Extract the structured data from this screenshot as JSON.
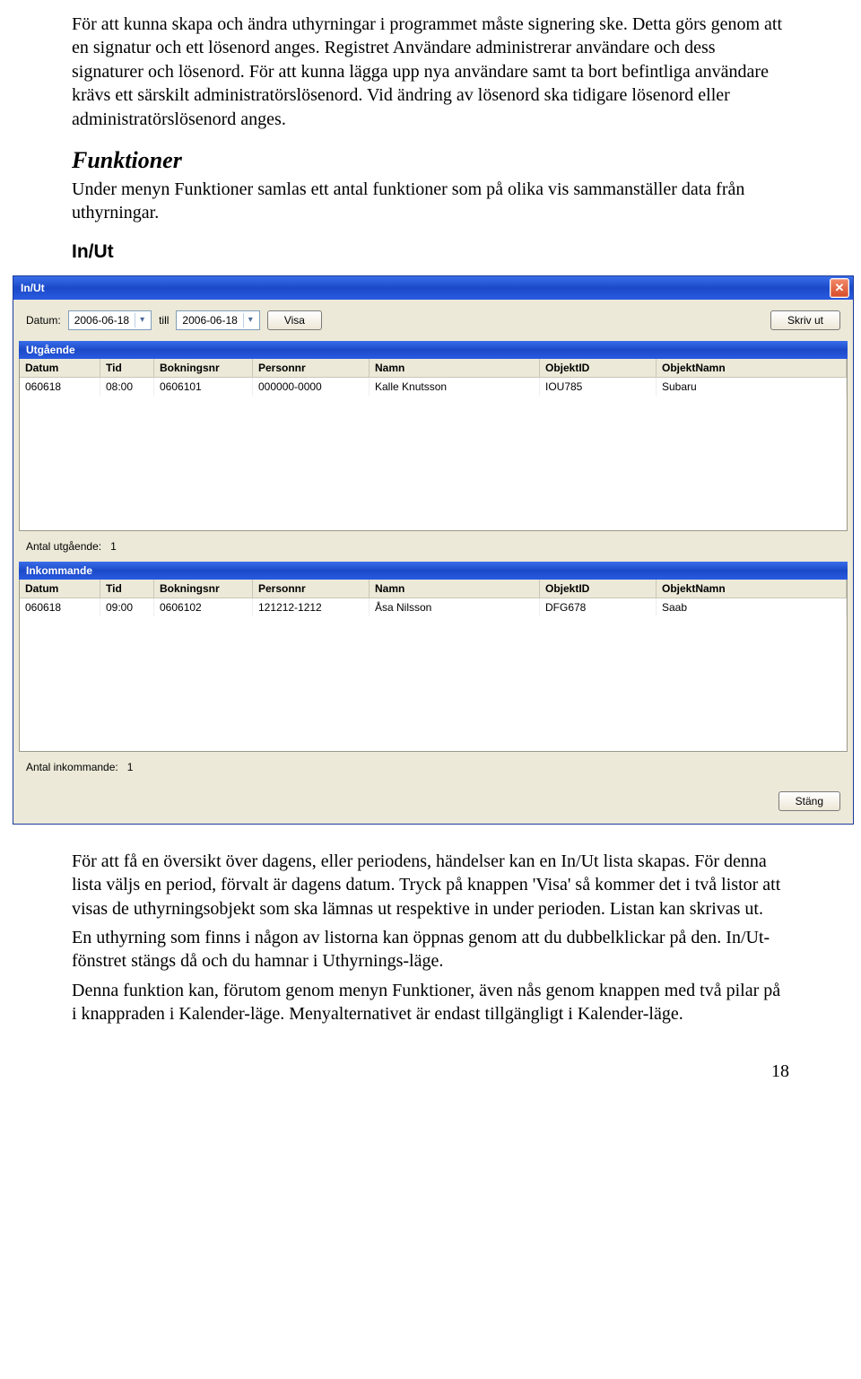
{
  "intro": {
    "p1": "För att kunna skapa och ändra uthyrningar i programmet måste signering ske. Detta görs genom att en signatur och ett lösenord anges. Registret Användare administrerar användare och dess signaturer och lösenord. För att kunna lägga upp nya användare samt ta bort befintliga användare krävs ett särskilt administratörslösenord. Vid ändring av lösenord ska tidigare lösenord eller administratörslösenord anges."
  },
  "funktioner": {
    "heading": "Funktioner",
    "p": "Under menyn Funktioner samlas ett antal funktioner som på olika vis sammanställer data från uthyrningar."
  },
  "inut_heading": "In/Ut",
  "dialog": {
    "title": "In/Ut",
    "labels": {
      "datum": "Datum:",
      "till": "till",
      "visa": "Visa",
      "skrivut": "Skriv ut",
      "stang": "Stäng"
    },
    "date_from": "2006-06-18",
    "date_to": "2006-06-18",
    "outgoing": {
      "title": "Utgående",
      "headers": [
        "Datum",
        "Tid",
        "Bokningsnr",
        "Personnr",
        "Namn",
        "ObjektID",
        "ObjektNamn"
      ],
      "rows": [
        [
          "060618",
          "08:00",
          "0606101",
          "000000-0000",
          "Kalle Knutsson",
          "IOU785",
          "Subaru"
        ]
      ],
      "count_label": "Antal utgående:",
      "count": "1"
    },
    "incoming": {
      "title": "Inkommande",
      "headers": [
        "Datum",
        "Tid",
        "Bokningsnr",
        "Personnr",
        "Namn",
        "ObjektID",
        "ObjektNamn"
      ],
      "rows": [
        [
          "060618",
          "09:00",
          "0606102",
          "121212-1212",
          "Åsa Nilsson",
          "DFG678",
          "Saab"
        ]
      ],
      "count_label": "Antal inkommande:",
      "count": "1"
    }
  },
  "after": {
    "p1": "För att få en översikt över dagens, eller periodens, händelser kan en In/Ut lista skapas. För denna lista väljs en period, förvalt är dagens datum. Tryck på knappen 'Visa' så kommer det i två listor att visas de uthyrningsobjekt som ska lämnas ut respektive in under perioden. Listan kan skrivas ut.",
    "p2": "En uthyrning som finns i någon av listorna kan öppnas genom att du dubbelklickar på den. In/Ut-fönstret stängs då och du hamnar i Uthyrnings-läge.",
    "p3": "Denna funktion kan, förutom genom menyn Funktioner, även nås genom knappen med två pilar på i knappraden i Kalender-läge. Menyalternativet är endast tillgängligt i Kalender-läge."
  },
  "page_number": "18"
}
